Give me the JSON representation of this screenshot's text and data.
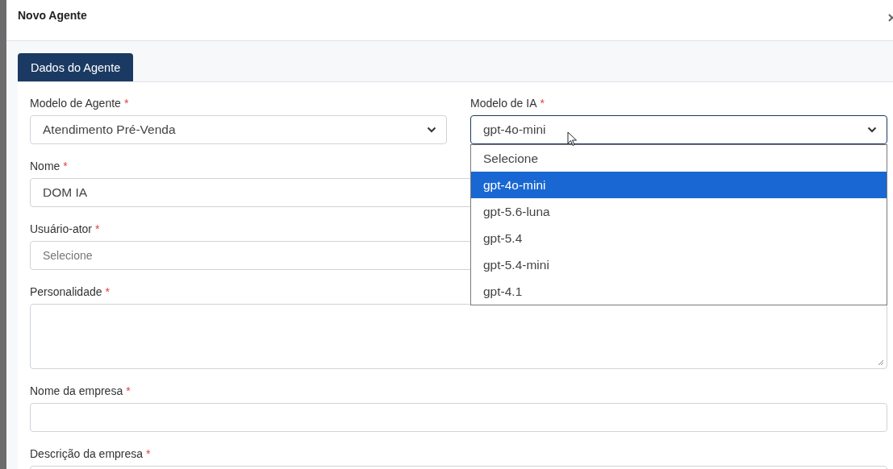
{
  "modal": {
    "title": "Novo Agente"
  },
  "tabs": [
    {
      "label": "Dados do Agente",
      "selected": true
    }
  ],
  "rows": [
    [
      {
        "kind": "select",
        "label": "Modelo de Agente",
        "required_mark": "*",
        "value": "Atendimento Pré-Venda"
      },
      {
        "kind": "select",
        "label": "Modelo de IA",
        "required_mark": "*",
        "value": "gpt-4o-mini",
        "expanded": true,
        "options": [
          {
            "label": "Selecione",
            "selected": false
          },
          {
            "label": "gpt-4o-mini",
            "selected": true
          },
          {
            "label": "gpt-5.6-luna",
            "selected": false
          },
          {
            "label": "gpt-5.4",
            "selected": false
          },
          {
            "label": "gpt-5.4-mini",
            "selected": false
          },
          {
            "label": "gpt-4.1",
            "selected": false
          }
        ]
      }
    ],
    [
      {
        "kind": "input",
        "label": "Nome",
        "required_mark": "*",
        "value": "DOM IA"
      }
    ],
    [
      {
        "kind": "select",
        "label": "Usuário-ator",
        "required_mark": "*",
        "placeholder": "Selecione"
      }
    ],
    [
      {
        "kind": "textarea",
        "label": "Personalidade",
        "required_mark": "*"
      }
    ],
    [
      {
        "kind": "input",
        "label": "Nome da empresa",
        "required_mark": "*"
      }
    ],
    [
      {
        "kind": "input",
        "label": "Descrição da empresa",
        "required_mark": "*"
      }
    ]
  ]
}
